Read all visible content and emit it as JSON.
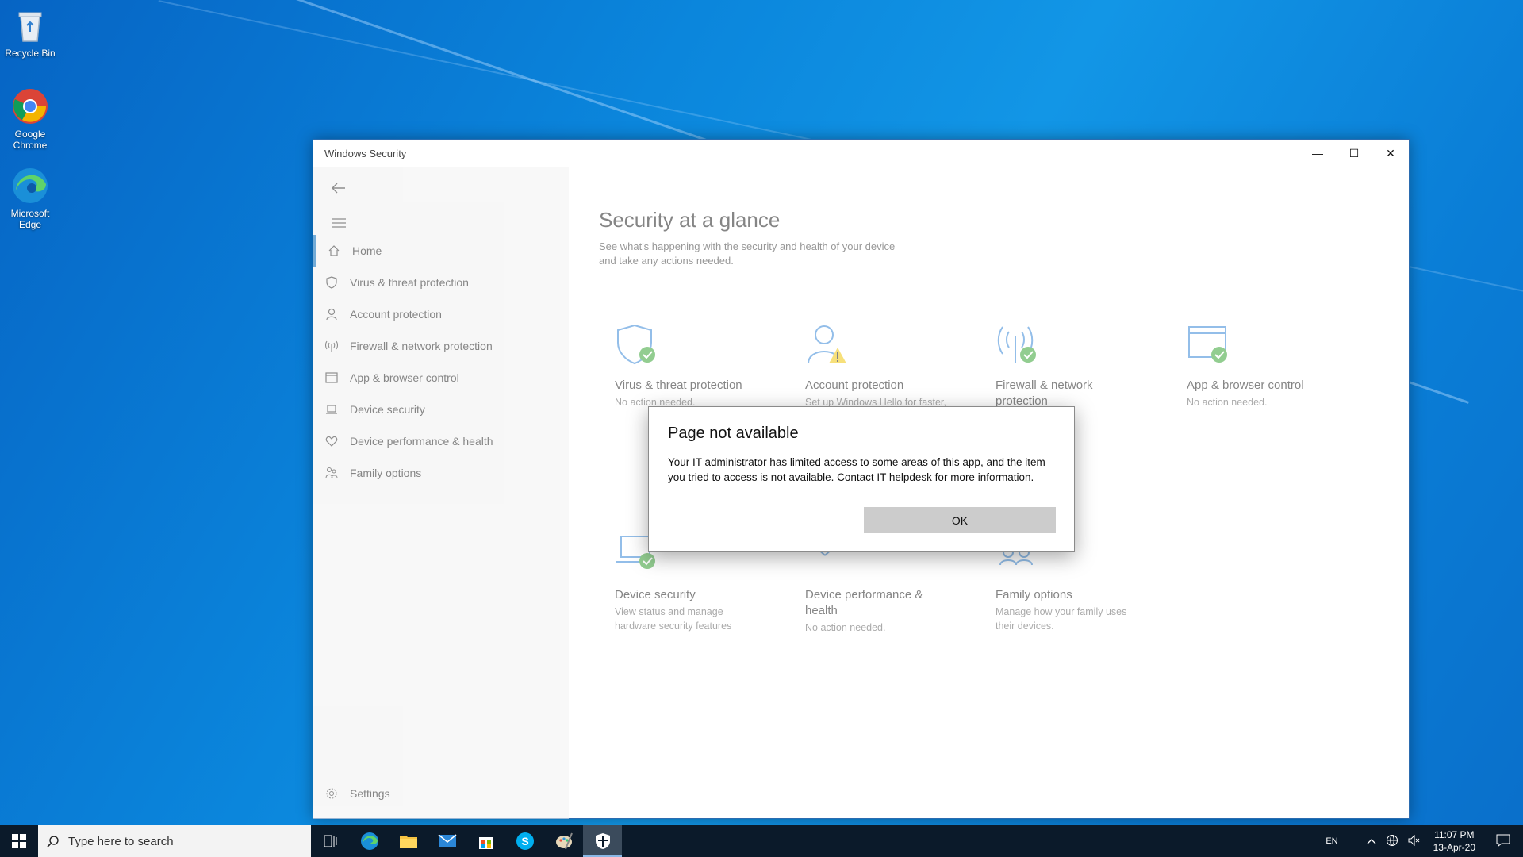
{
  "desktop": {
    "icons": [
      {
        "label": "Recycle Bin"
      },
      {
        "label": "Google Chrome"
      },
      {
        "label": "Microsoft Edge"
      }
    ]
  },
  "window": {
    "title": "Windows Security",
    "minimize": "—",
    "maximize": "☐",
    "close": "✕"
  },
  "sidebar": {
    "items": [
      {
        "label": "Home",
        "icon": "home-icon"
      },
      {
        "label": "Virus & threat protection",
        "icon": "shield-icon"
      },
      {
        "label": "Account protection",
        "icon": "person-icon"
      },
      {
        "label": "Firewall & network protection",
        "icon": "antenna-icon"
      },
      {
        "label": "App & browser control",
        "icon": "browser-window-icon"
      },
      {
        "label": "Device security",
        "icon": "laptop-icon"
      },
      {
        "label": "Device performance & health",
        "icon": "heart-icon"
      },
      {
        "label": "Family options",
        "icon": "family-icon"
      }
    ],
    "settings_label": "Settings"
  },
  "main": {
    "title": "Security at a glance",
    "subtitle": "See what's happening with the security and health of your device and take any actions needed.",
    "cards": [
      {
        "title": "Virus & threat protection",
        "desc": "No action needed."
      },
      {
        "title": "Account protection",
        "desc": "Set up Windows Hello for faster,"
      },
      {
        "title": "Firewall & network protection",
        "desc": ""
      },
      {
        "title": "App & browser control",
        "desc": "No action needed."
      },
      {
        "title": "Device security",
        "desc": "View status and manage hardware security features"
      },
      {
        "title": "Device performance & health",
        "desc": "No action needed."
      },
      {
        "title": "Family options",
        "desc": "Manage how your family uses their devices."
      }
    ]
  },
  "dialog": {
    "title": "Page not available",
    "body": "Your IT administrator has limited access to some areas of this app, and the item you tried to access is not available. Contact IT helpdesk for more information.",
    "ok_label": "OK"
  },
  "taskbar": {
    "search_placeholder": "Type here to search",
    "language": "EN",
    "time": "11:07 PM",
    "date": "13-Apr-20"
  },
  "colors": {
    "accent": "#0067b8",
    "check_green": "#3aa537",
    "warning_yellow": "#f2c80f",
    "icon_blue": "#3c8ad8"
  }
}
